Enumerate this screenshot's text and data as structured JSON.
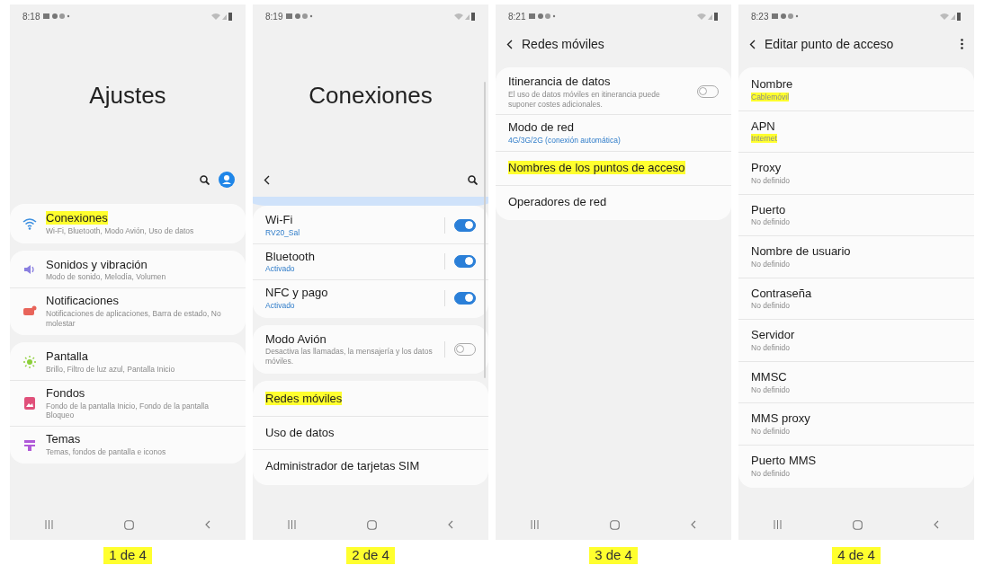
{
  "screens": [
    {
      "time": "8:18",
      "header": {
        "kind": "home",
        "title": "Ajustes"
      },
      "groups": [
        [
          {
            "title": "Conexiones",
            "subtitle": "Wi-Fi, Bluetooth, Modo Avión, Uso de datos",
            "subtitle_accent": false,
            "title_highlighted": true,
            "subtitle_highlighted": false,
            "color": "#3d8fe0"
          }
        ],
        [
          {
            "title": "Sonidos y vibración",
            "subtitle": "Modo de sonido, Melodía, Volumen",
            "subtitle_accent": false,
            "title_highlighted": false,
            "subtitle_highlighted": false,
            "color": "#8a7fe0"
          },
          {
            "title": "Notificaciones",
            "subtitle": "Notificaciones de aplicaciones, Barra de estado, No molestar",
            "subtitle_accent": false,
            "title_highlighted": false,
            "subtitle_highlighted": false,
            "color": "#e8645a"
          }
        ],
        [
          {
            "title": "Pantalla",
            "subtitle": "Brillo, Filtro de luz azul, Pantalla Inicio",
            "subtitle_accent": false,
            "title_highlighted": false,
            "subtitle_highlighted": false,
            "color": "#8ccf3a"
          },
          {
            "title": "Fondos",
            "subtitle": "Fondo de la pantalla Inicio, Fondo de la pantalla Bloqueo",
            "subtitle_accent": false,
            "title_highlighted": false,
            "subtitle_highlighted": false,
            "color": "#e0507a"
          },
          {
            "title": "Temas",
            "subtitle": "Temas, fondos de pantalla e iconos",
            "subtitle_accent": false,
            "title_highlighted": false,
            "subtitle_highlighted": false,
            "color": "#b05ad8"
          }
        ]
      ],
      "caption": "1 de 4"
    },
    {
      "time": "8:19",
      "header": {
        "kind": "section",
        "title": "Conexiones"
      },
      "groups": [
        [
          {
            "title": "Wi-Fi",
            "subtitle": "RV20_Sal",
            "subtitle_accent": true,
            "title_highlighted": false,
            "subtitle_highlighted": false,
            "toggle": {
              "on": true
            }
          },
          {
            "title": "Bluetooth",
            "subtitle": "Activado",
            "subtitle_accent": true,
            "title_highlighted": false,
            "subtitle_highlighted": false,
            "toggle": {
              "on": true
            }
          },
          {
            "title": "NFC y pago",
            "subtitle": "Activado",
            "subtitle_accent": true,
            "title_highlighted": false,
            "subtitle_highlighted": false,
            "toggle": {
              "on": true
            }
          }
        ],
        [
          {
            "title": "Modo Avión",
            "subtitle": "Desactiva las llamadas, la mensajería y los datos móviles.",
            "subtitle_accent": false,
            "title_highlighted": false,
            "subtitle_highlighted": false,
            "toggle": {
              "on": false
            }
          }
        ],
        [
          {
            "title": "Redes móviles",
            "title_highlighted": true,
            "subtitle_highlighted": false
          },
          {
            "title": "Uso de datos",
            "title_highlighted": false,
            "subtitle_highlighted": false
          },
          {
            "title": "Administrador de tarjetas SIM",
            "title_highlighted": false,
            "subtitle_highlighted": false
          }
        ]
      ],
      "caption": "2 de 4"
    },
    {
      "time": "8:21",
      "header": {
        "kind": "bar",
        "title": "Redes móviles"
      },
      "groups": [
        [
          {
            "title": "Itinerancia de datos",
            "subtitle": "El uso de datos móviles en itinerancia puede suponer costes adicionales.",
            "subtitle_accent": false,
            "title_highlighted": false,
            "subtitle_highlighted": false,
            "toggle": {
              "on": false
            }
          },
          {
            "title": "Modo de red",
            "subtitle": "4G/3G/2G (conexión automática)",
            "subtitle_accent": true,
            "title_highlighted": false,
            "subtitle_highlighted": false
          },
          {
            "title": "Nombres de los puntos de acceso",
            "title_highlighted": true,
            "subtitle_highlighted": false
          },
          {
            "title": "Operadores de red",
            "title_highlighted": false,
            "subtitle_highlighted": false
          }
        ]
      ],
      "caption": "3 de 4"
    },
    {
      "time": "8:23",
      "header": {
        "kind": "bar_menu",
        "title": "Editar punto de acceso"
      },
      "groups": [
        [
          {
            "title": "Nombre",
            "subtitle": "Cablemóvil",
            "subtitle_accent": false,
            "title_highlighted": false,
            "subtitle_highlighted": true
          },
          {
            "title": "APN",
            "subtitle": "Internet",
            "subtitle_accent": false,
            "title_highlighted": false,
            "subtitle_highlighted": true
          },
          {
            "title": "Proxy",
            "subtitle": "No definido",
            "subtitle_accent": false,
            "title_highlighted": false,
            "subtitle_highlighted": false
          },
          {
            "title": "Puerto",
            "subtitle": "No definido",
            "subtitle_accent": false,
            "title_highlighted": false,
            "subtitle_highlighted": false
          },
          {
            "title": "Nombre de usuario",
            "subtitle": "No definido",
            "subtitle_accent": false,
            "title_highlighted": false,
            "subtitle_highlighted": false
          },
          {
            "title": "Contraseña",
            "subtitle": "No definido",
            "subtitle_accent": false,
            "title_highlighted": false,
            "subtitle_highlighted": false
          },
          {
            "title": "Servidor",
            "subtitle": "No definido",
            "subtitle_accent": false,
            "title_highlighted": false,
            "subtitle_highlighted": false
          },
          {
            "title": "MMSC",
            "subtitle": "No definido",
            "subtitle_accent": false,
            "title_highlighted": false,
            "subtitle_highlighted": false
          },
          {
            "title": "MMS proxy",
            "subtitle": "No definido",
            "subtitle_accent": false,
            "title_highlighted": false,
            "subtitle_highlighted": false
          },
          {
            "title": "Puerto MMS",
            "subtitle": "No definido",
            "subtitle_accent": false,
            "title_highlighted": false,
            "subtitle_highlighted": false
          }
        ]
      ],
      "caption": "4 de 4"
    }
  ]
}
